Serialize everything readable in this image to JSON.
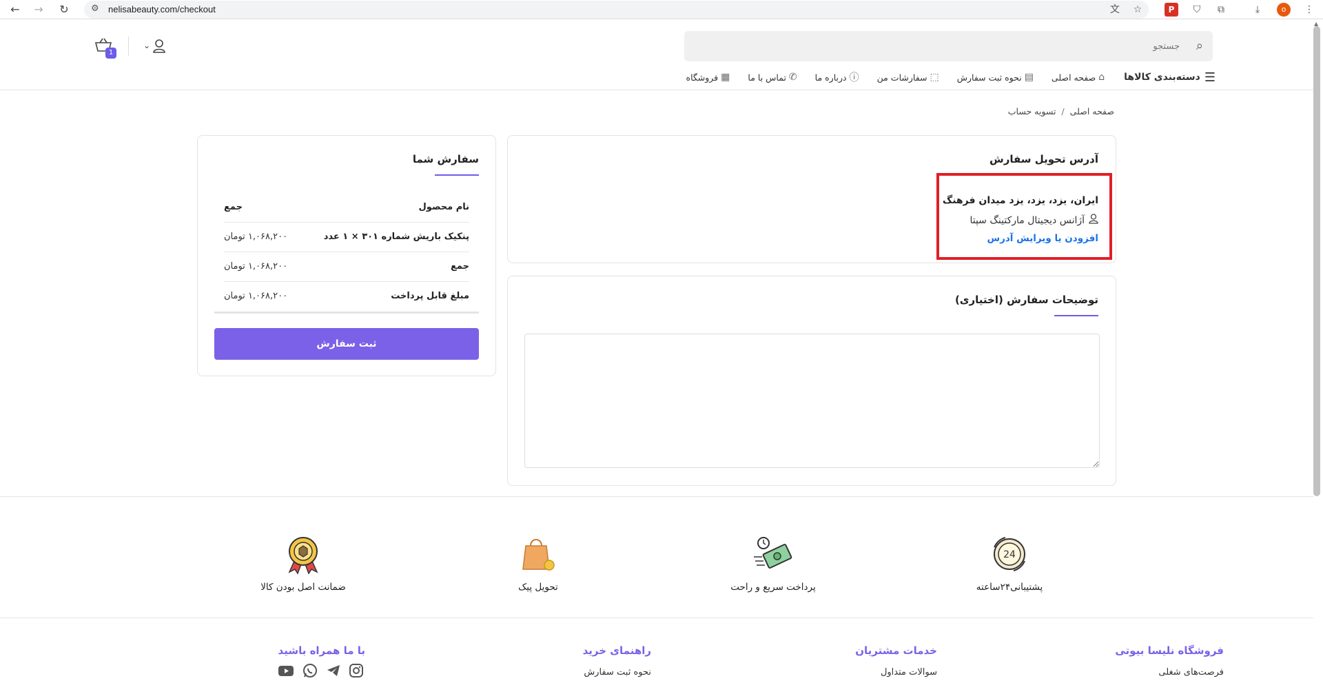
{
  "browser": {
    "url": "nelisabeauty.com/checkout",
    "profile_initial": "o",
    "pdf_label": "P"
  },
  "header": {
    "search_placeholder": "جستجو",
    "cart_count": "1"
  },
  "nav": {
    "categories": "دسته‌بندی کالاها",
    "items": [
      "صفحه اصلی",
      "نحوه ثبت سفارش",
      "سفارشات من",
      "درباره ما",
      "تماس با ما",
      "فروشگاه"
    ]
  },
  "breadcrumb": {
    "home": "صفحه اصلی",
    "separator": "/",
    "current": "تسویه حساب"
  },
  "address_card": {
    "title": "آدرس تحویل سفارش",
    "address": "ایران، یزد، یزد، یزد میدان فرهنگ",
    "recipient": "آژانس دیجیتال مارکتینگ سپتا",
    "edit_link": "افزودن یا ویرایش آدرس"
  },
  "notes_card": {
    "title": "توضیحات سفارش (اختیاری)",
    "value": ""
  },
  "order_card": {
    "title": "سفارش شما",
    "header": {
      "product": "نام محصول",
      "total": "جمع"
    },
    "rows": [
      {
        "label": "پنکیک باریش شماره ۳۰۱ × ۱ عدد",
        "value": "۱,۰۶۸,۲۰۰ تومان"
      },
      {
        "label": "جمع",
        "value": "۱,۰۶۸,۲۰۰ تومان"
      },
      {
        "label": "مبلغ قابل پرداخت",
        "value": "۱,۰۶۸,۲۰۰ تومان"
      }
    ],
    "submit_label": "ثبت سفارش"
  },
  "features": [
    {
      "label": "پشتیبانی۲۴ساعته",
      "icon": "support-24h-icon"
    },
    {
      "label": "پرداخت سریع و راحت",
      "icon": "fast-payment-icon"
    },
    {
      "label": "تحویل پیک",
      "icon": "courier-delivery-icon"
    },
    {
      "label": "ضمانت اصل بودن کالا",
      "icon": "authenticity-badge-icon"
    }
  ],
  "footer": {
    "columns": [
      {
        "title": "فروشگاه نلیسا بیوتی",
        "link": "فرصت‌های شغلی"
      },
      {
        "title": "خدمات مشتریان",
        "link": "سوالات متداول"
      },
      {
        "title": "راهنمای خرید",
        "link": "نحوه ثبت سفارش"
      },
      {
        "title": "با ما همراه باشید",
        "link": ""
      }
    ]
  },
  "colors": {
    "accent": "#7b61e8",
    "highlight": "#e01f26",
    "link": "#1a73e8"
  }
}
